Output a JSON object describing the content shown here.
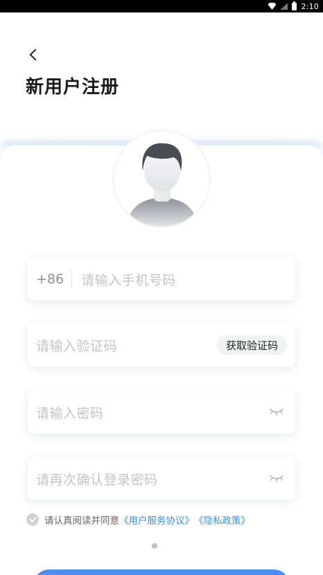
{
  "status_bar": {
    "time": "2:10",
    "icons": [
      "wifi-icon",
      "signal-icon",
      "battery-icon"
    ]
  },
  "header": {
    "back_icon": "chevron-left-icon",
    "title": "新用户注册"
  },
  "avatar": {
    "icon": "default-avatar-icon"
  },
  "form": {
    "phone": {
      "country_code": "+86",
      "placeholder": "请输入手机号码",
      "value": ""
    },
    "verify_code": {
      "placeholder": "请输入验证码",
      "value": "",
      "button_label": "获取验证码"
    },
    "password": {
      "placeholder": "请输入密码",
      "value": "",
      "toggle_icon": "eye-closed-icon"
    },
    "confirm_password": {
      "placeholder": "请再次确认登录密码",
      "value": "",
      "toggle_icon": "eye-closed-icon"
    }
  },
  "agreement": {
    "checked": false,
    "prefix": "请认真阅读并同意",
    "user_agreement": "《用户服务协议》",
    "privacy_policy": "《隐私政策》"
  },
  "colors": {
    "accent": "#4d8ef0",
    "link": "#3d8fea",
    "placeholder": "#c2c4c8"
  }
}
